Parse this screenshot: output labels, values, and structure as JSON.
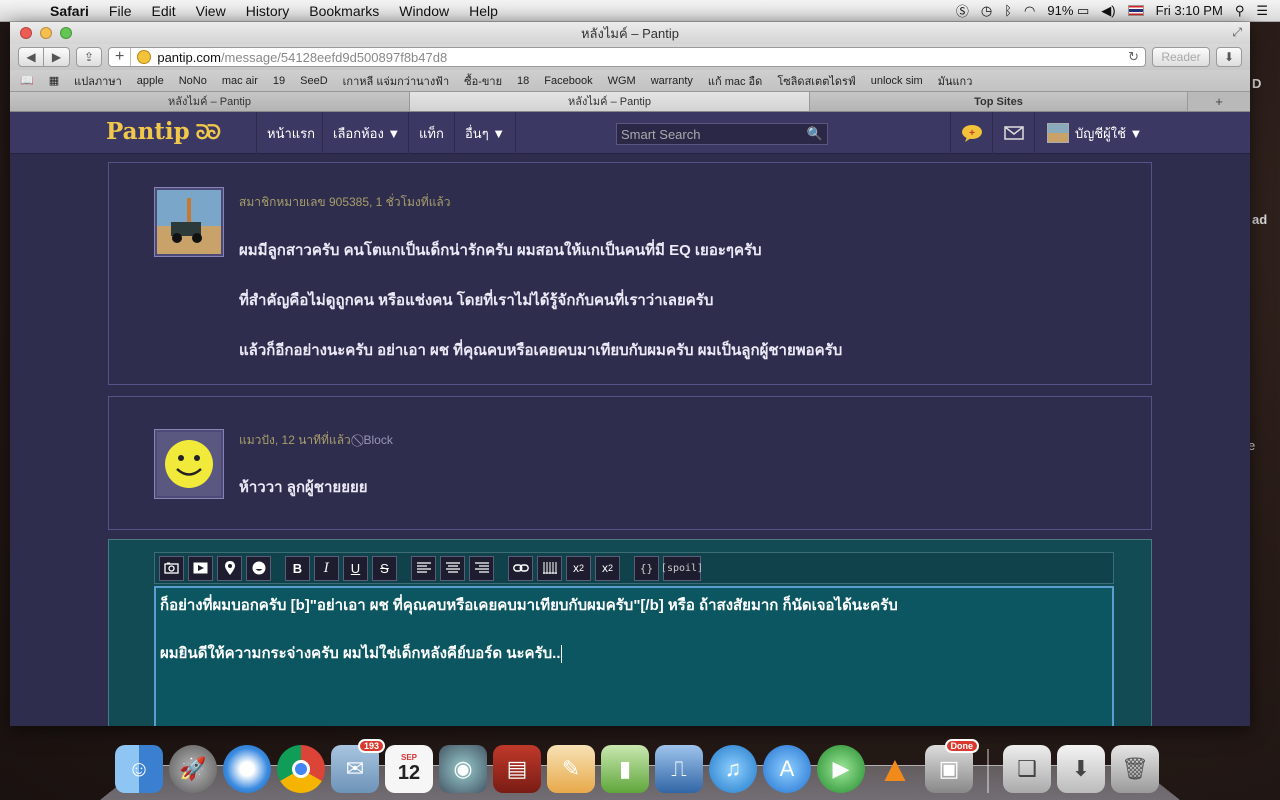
{
  "menubar": {
    "app": "Safari",
    "items": [
      "File",
      "Edit",
      "View",
      "History",
      "Bookmarks",
      "Window",
      "Help"
    ],
    "battery": "91%",
    "clock": "Fri 3:10 PM"
  },
  "window": {
    "title": "หลังไมค์ – Pantip"
  },
  "toolbar": {
    "url_domain": "pantip.com",
    "url_path": "/message/54128eefd9d500897f8b47d8",
    "reader_label": "Reader",
    "add_label": "+"
  },
  "bookmarks": [
    "แปลภาษา",
    "apple",
    "NoNo",
    "mac air",
    "19",
    "SeeD",
    "เกาหลี แจ่มกว่านางฟ้า",
    "ซื้อ-ขาย",
    "18",
    "Facebook",
    "WGM",
    "warranty",
    "แก้ mac อืด",
    "โซลิดสเตตไดรฟ์",
    "unlock sim",
    "มันแกว"
  ],
  "tabs": [
    "หลังไมค์ – Pantip",
    "หลังไมค์ – Pantip",
    "Top Sites"
  ],
  "pantip": {
    "logo": "Pantip",
    "logo_mark": "ᘐᘐ",
    "nav": [
      "หน้าแรก",
      "เลือกห้อง ▼",
      "แท็ก",
      "อื่นๆ ▼"
    ],
    "search_placeholder": "Smart Search",
    "account_label": "บัญชีผู้ใช้ ▼"
  },
  "comments": [
    {
      "meta": "สมาชิกหมายเลข 905385, 1 ชั่วโมงที่แล้ว",
      "lines": [
        "ผมมีลูกสาวครับ คนโตแกเป็นเด็กน่ารักครับ ผมสอนให้แกเป็นคนที่มี EQ เยอะๆครับ",
        "ที่สำคัญคือไม่ดูถูกคน หรือแช่งคน โดยที่เราไม่ได้รู้จักกับคนที่เราว่าเลยครับ",
        "แล้วก็อีกอย่างนะครับ อย่าเอา ผช ที่คุณคบหรือเคยคบมาเทียบกับผมครับ ผมเป็นลูกผู้ชายพอครับ"
      ]
    },
    {
      "meta": "แมวปัง, 12 นาทีที่แล้ว",
      "block_label": "Block",
      "lines": [
        "ห้าววา ลูกผู้ชายยยย"
      ]
    }
  ],
  "editor": {
    "buttons": [
      "B",
      "I",
      "U",
      "S",
      "{}",
      "[spoil]"
    ],
    "line1": "ก็อย่างที่ผมบอกครับ [b]\"อย่าเอา ผช ที่คุณคบหรือเคยคบมาเทียบกับผมครับ\"[/b] หรือ ถ้าสงสัยมาก ก็นัดเจอได้นะครับ",
    "line2": "ผมยินดีให้ความกระจ่างครับ ผมไม่ใช่เด็กหลังคีย์บอร์ด นะครับ.."
  },
  "dock": {
    "mail_badge": "193",
    "calendar_month": "SEP",
    "calendar_day": "12",
    "done_badge": "Done"
  },
  "desktop_edge": [
    "D",
    "ad",
    "e"
  ],
  "colors": {
    "pantip_header": "#3c3864",
    "pantip_bg": "#2f2d4e",
    "logo": "#f2c84b",
    "editor_bg": "#0b5660"
  }
}
